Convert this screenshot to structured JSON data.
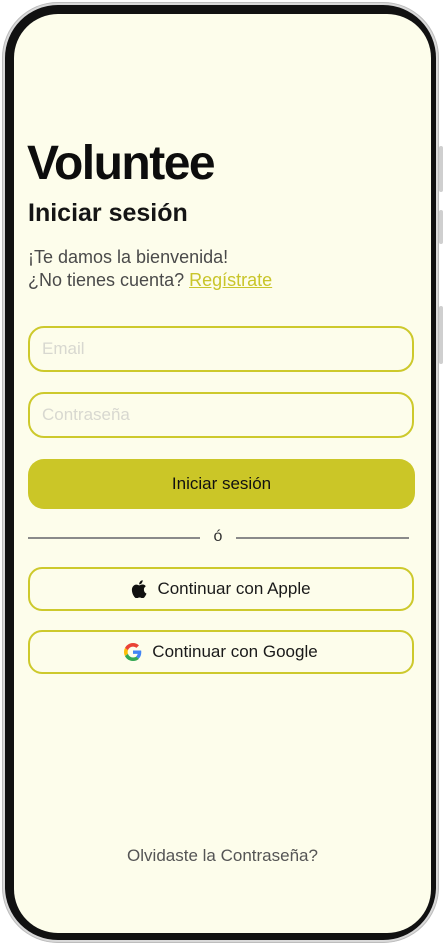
{
  "app": {
    "brand": "Voluntee"
  },
  "login": {
    "title": "Iniciar sesión",
    "welcome": "¡Te damos la bienvenida!",
    "no_account": "¿No tienes cuenta?",
    "register_link": "Regístrate",
    "email_placeholder": "Email",
    "password_placeholder": "Contraseña",
    "submit_label": "Iniciar sesión",
    "divider": "ó",
    "apple_label": "Continuar con Apple",
    "google_label": "Continuar con Google",
    "forgot_password": "Olvidaste la Contraseña?"
  },
  "colors": {
    "background": "#fdfdeb",
    "accent": "#cbc627",
    "text": "#151515"
  },
  "icons": {
    "apple": "apple-icon",
    "google": "google-icon"
  }
}
